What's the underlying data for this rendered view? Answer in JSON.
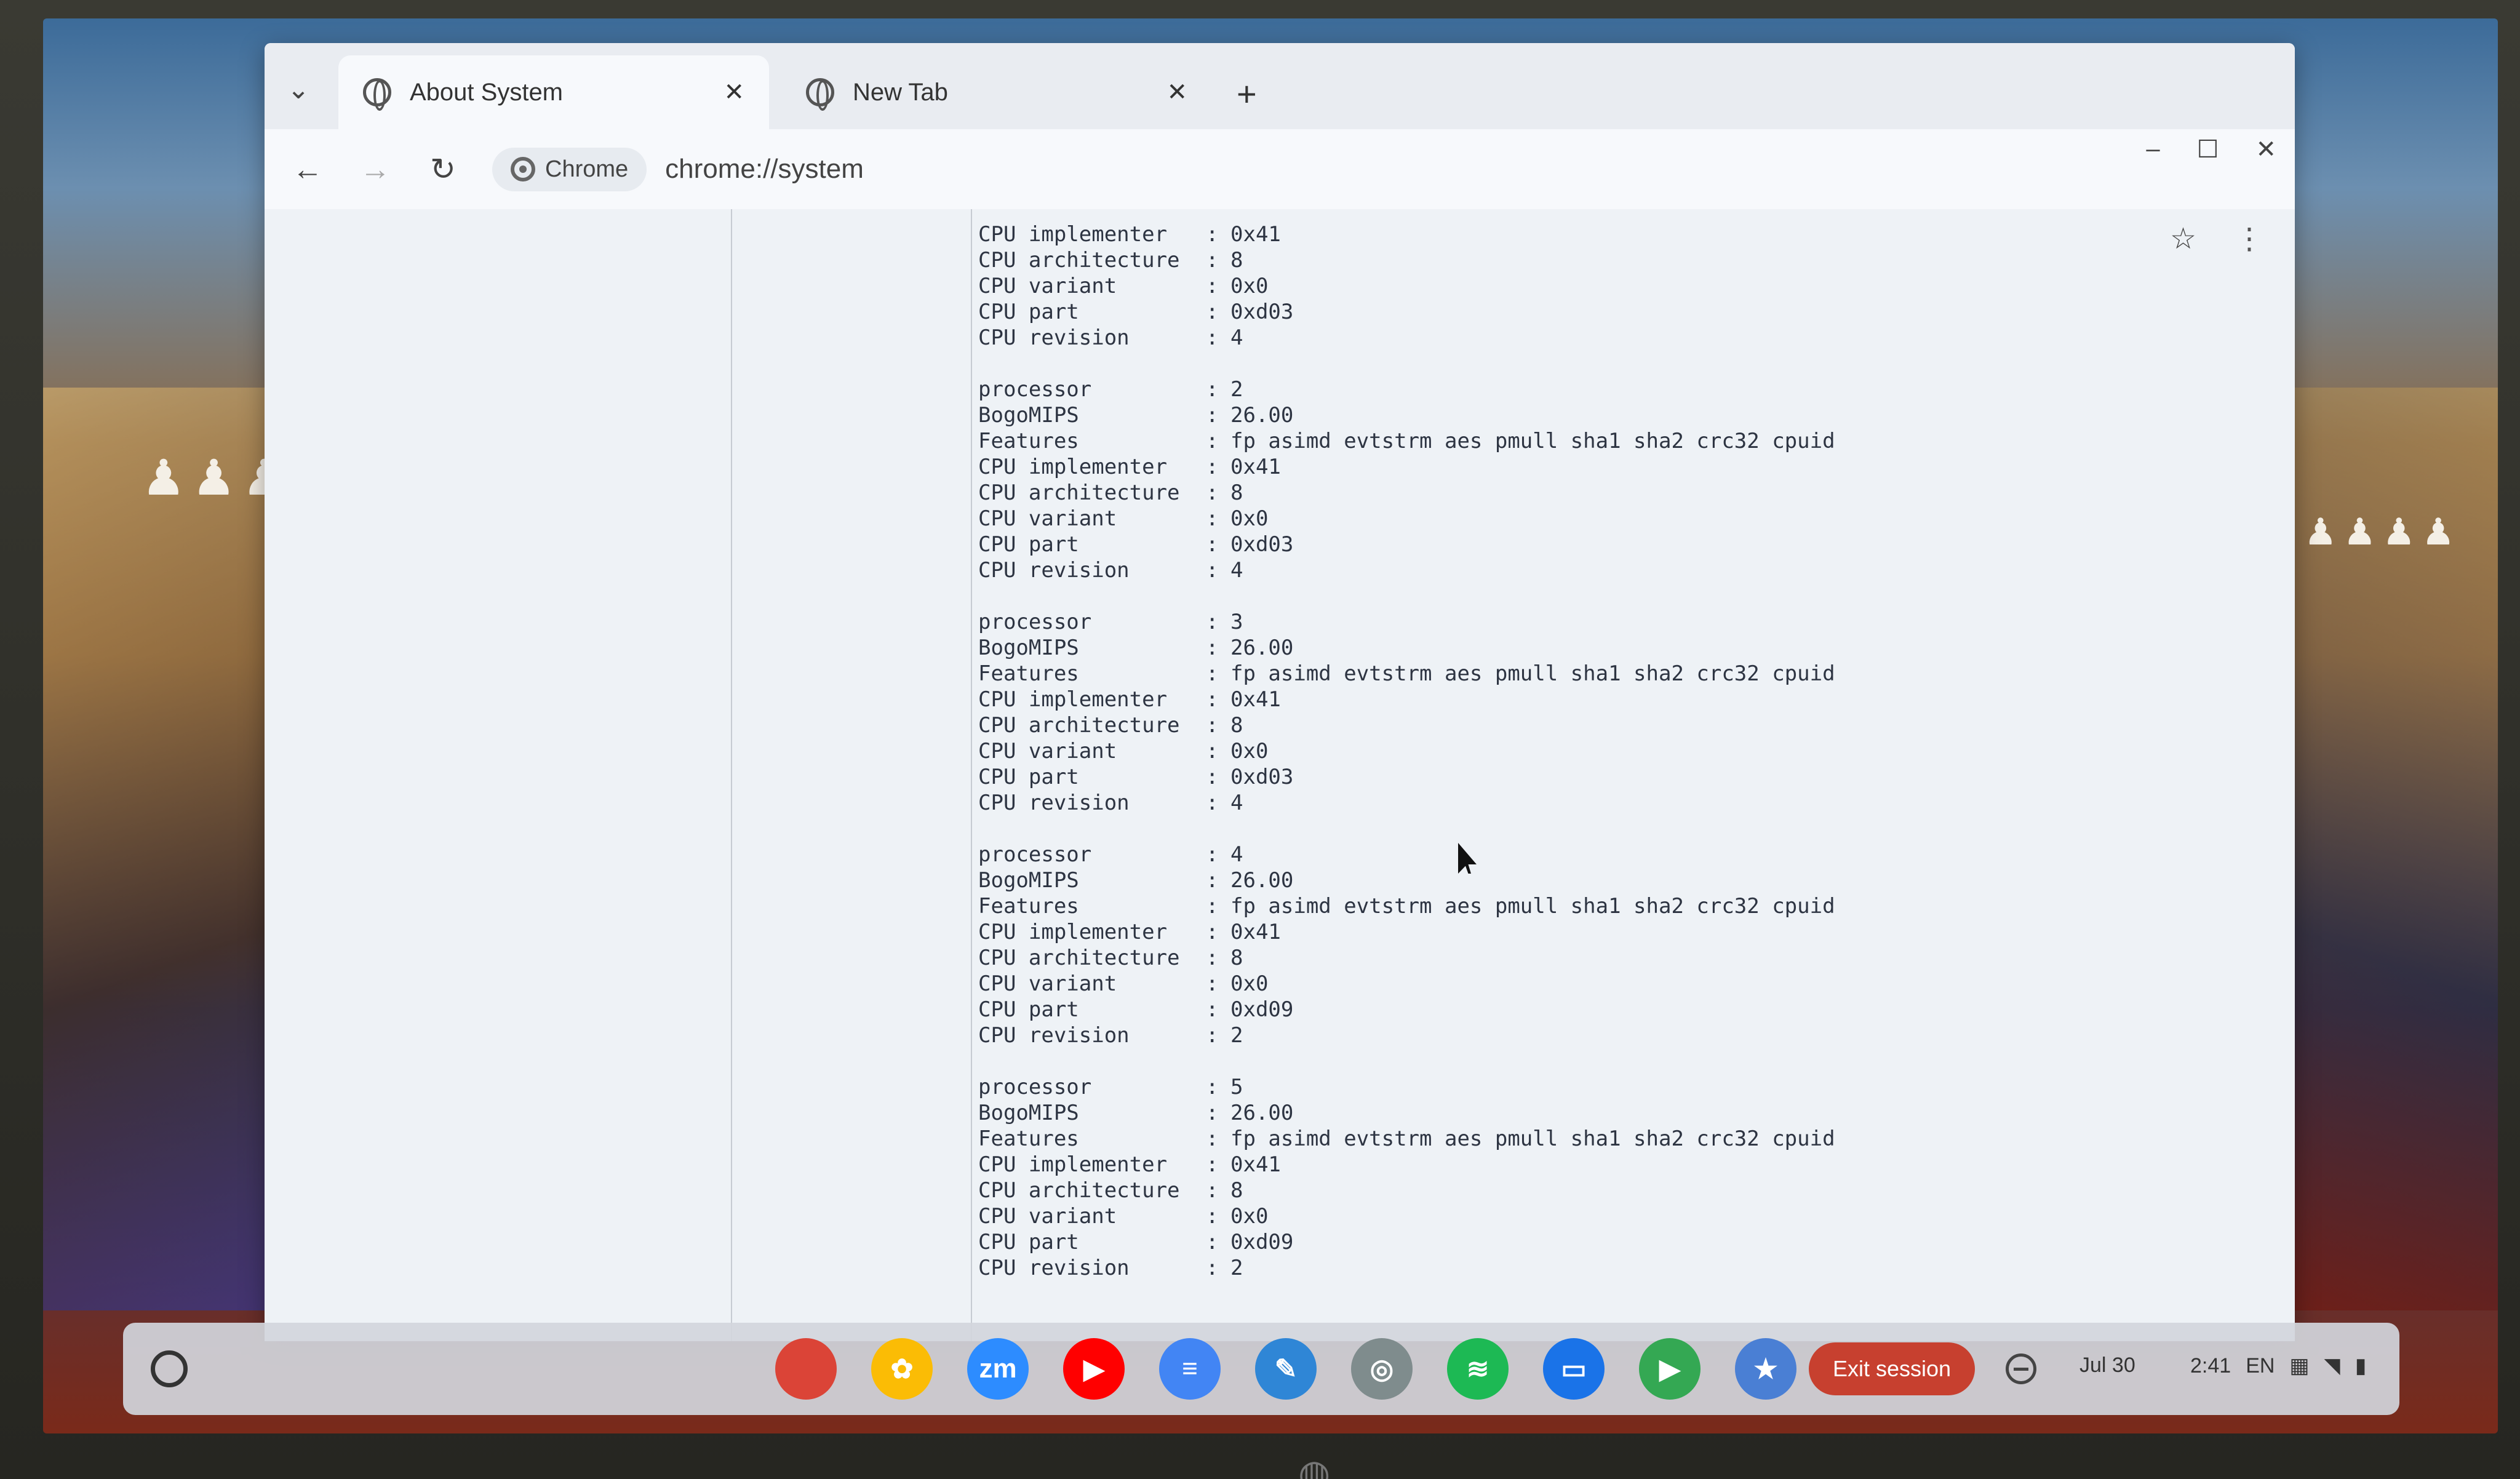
{
  "tabs": [
    {
      "title": "About System",
      "active": true
    },
    {
      "title": "New Tab",
      "active": false
    }
  ],
  "toolbar": {
    "chip_label": "Chrome",
    "url": "chrome://system"
  },
  "window_controls": {
    "minimize": "–",
    "maximize": "☐",
    "close": "✕"
  },
  "log": {
    "head": [
      {
        "key": "CPU implementer",
        "value": "0x41"
      },
      {
        "key": "CPU architecture",
        "value": "8"
      },
      {
        "key": "CPU variant",
        "value": "0x0"
      },
      {
        "key": "CPU part",
        "value": "0xd03"
      },
      {
        "key": "CPU revision",
        "value": "4"
      }
    ],
    "processors": [
      {
        "processor": "2",
        "bogomips": "26.00",
        "features": "fp asimd evtstrm aes pmull sha1 sha2 crc32 cpuid",
        "implementer": "0x41",
        "architecture": "8",
        "variant": "0x0",
        "part": "0xd03",
        "revision": "4"
      },
      {
        "processor": "3",
        "bogomips": "26.00",
        "features": "fp asimd evtstrm aes pmull sha1 sha2 crc32 cpuid",
        "implementer": "0x41",
        "architecture": "8",
        "variant": "0x0",
        "part": "0xd03",
        "revision": "4"
      },
      {
        "processor": "4",
        "bogomips": "26.00",
        "features": "fp asimd evtstrm aes pmull sha1 sha2 crc32 cpuid",
        "implementer": "0x41",
        "architecture": "8",
        "variant": "0x0",
        "part": "0xd09",
        "revision": "2"
      },
      {
        "processor": "5",
        "bogomips": "26.00",
        "features": "fp asimd evtstrm aes pmull sha1 sha2 crc32 cpuid",
        "implementer": "0x41",
        "architecture": "8",
        "variant": "0x0",
        "part": "0xd09",
        "revision": "2"
      }
    ]
  },
  "shelf": {
    "apps": [
      {
        "name": "chrome-app-icon",
        "glyph": "",
        "color": "#db4437"
      },
      {
        "name": "photos-app-icon",
        "glyph": "✿",
        "color": "#fbbc05"
      },
      {
        "name": "zoom-app-icon",
        "glyph": "zm",
        "color": "#2d8cff"
      },
      {
        "name": "youtube-app-icon",
        "glyph": "▶",
        "color": "#ff0000"
      },
      {
        "name": "docs-app-icon",
        "glyph": "≡",
        "color": "#4285f4"
      },
      {
        "name": "canvas-app-icon",
        "glyph": "✎",
        "color": "#2f86d6"
      },
      {
        "name": "chrome-web-app-icon",
        "glyph": "◎",
        "color": "#7f8c8d"
      },
      {
        "name": "spotify-app-icon",
        "glyph": "≋",
        "color": "#1db954"
      },
      {
        "name": "files-app-icon",
        "glyph": "▭",
        "color": "#1a73e8"
      },
      {
        "name": "play-store-app-icon",
        "glyph": "▶",
        "color": "#34a853"
      },
      {
        "name": "starred-app-icon",
        "glyph": "★",
        "color": "#4a7fd4"
      }
    ],
    "exit_session": "Exit session",
    "date": "Jul 30",
    "time": "2:41",
    "lang": "EN"
  }
}
